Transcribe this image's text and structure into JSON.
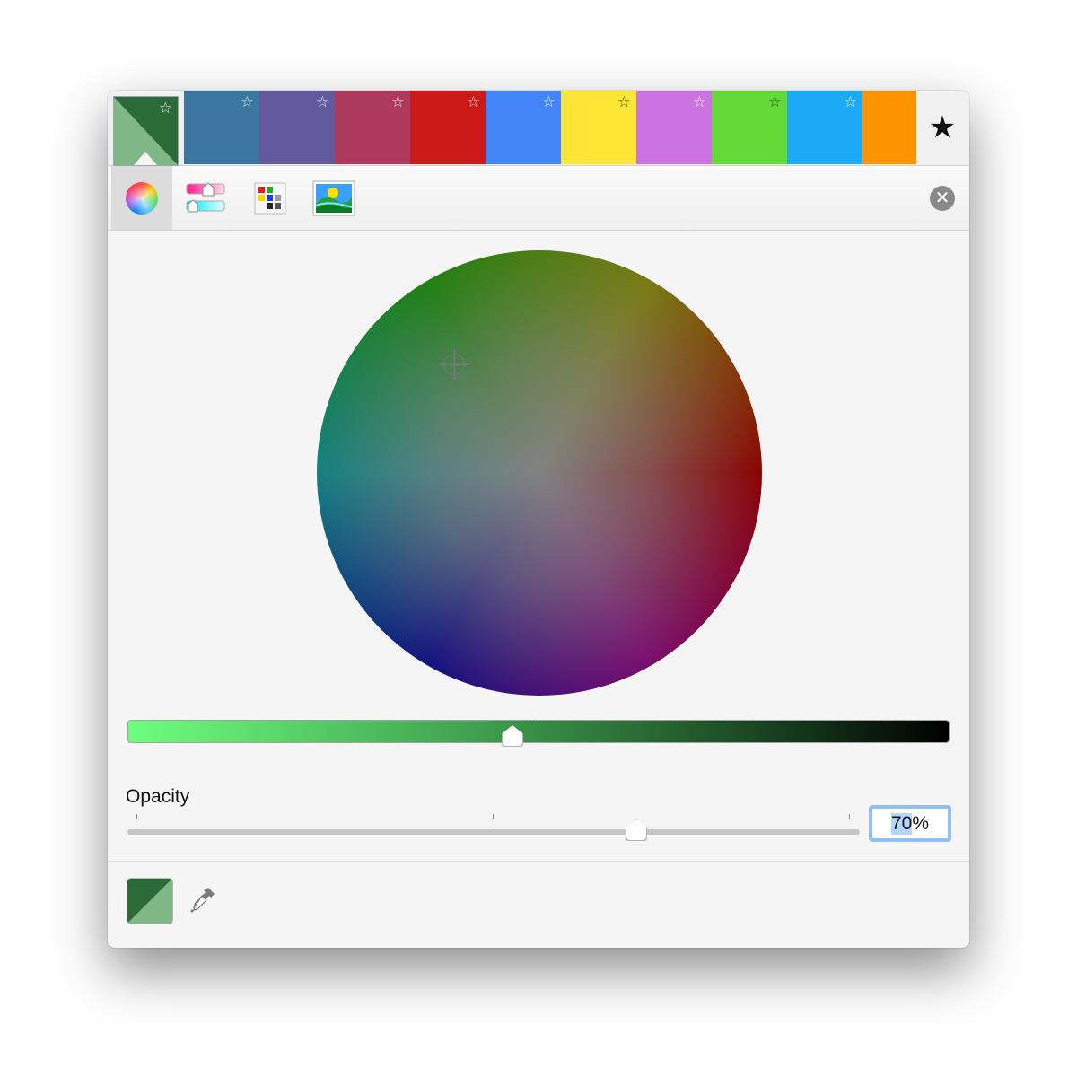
{
  "favorites": {
    "swatches": [
      {
        "color": "#3b77a0"
      },
      {
        "color": "#635a9e"
      },
      {
        "color": "#ad3a5e"
      },
      {
        "color": "#cd1a18"
      },
      {
        "color": "#4285f8"
      },
      {
        "color": "#ffe535"
      },
      {
        "color": "#cc73e1"
      },
      {
        "color": "#63da38"
      },
      {
        "color": "#1ca9f5"
      },
      {
        "color": "#fe9500"
      }
    ],
    "star_glyph": "☆",
    "add_favorite_glyph": "★",
    "current_color_top": "#2d6a3a",
    "current_color_bottom": "#7fb886"
  },
  "toolbar": {
    "tabs": [
      "color-wheel",
      "color-sliders",
      "color-palettes",
      "image-palettes"
    ],
    "active_tab": "color-wheel",
    "close_glyph": "✕"
  },
  "brightness": {
    "value_fraction": 0.47
  },
  "opacity": {
    "label": "Opacity",
    "value_fraction": 0.7,
    "field_selected": "70",
    "field_suffix": "%"
  },
  "bottom": {
    "current_color_top": "#2d6a3a",
    "current_color_bottom": "#7fb886"
  }
}
